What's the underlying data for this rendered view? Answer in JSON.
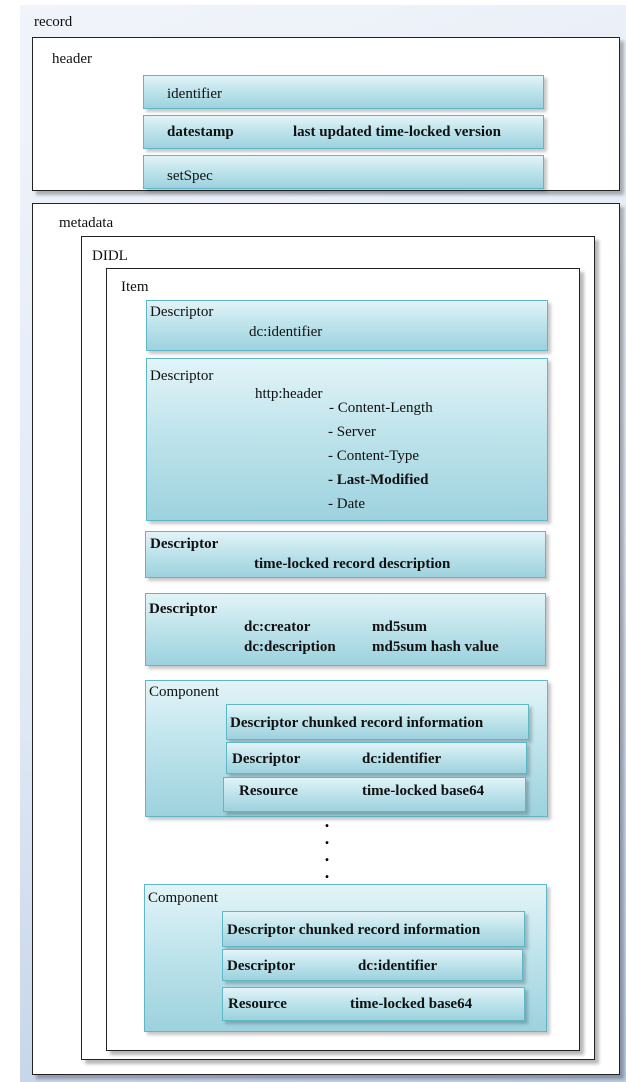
{
  "record": {
    "label": "record"
  },
  "header": {
    "label": "header",
    "identifier": "identifier",
    "datestamp": "datestamp",
    "datestamp_value": "last updated time-locked version",
    "setspec": "setSpec"
  },
  "metadata": {
    "label": "metadata"
  },
  "didl": {
    "label": "DIDL"
  },
  "item": {
    "label": "Item"
  },
  "descriptor1": {
    "label": "Descriptor",
    "value": "dc:identifier"
  },
  "descriptor2": {
    "label": "Descriptor",
    "key": "http:header",
    "fields": [
      "- Content-Length",
      "- Server",
      "- Content-Type",
      "- Last-Modified",
      "- Date"
    ]
  },
  "descriptor3": {
    "label": "Descriptor",
    "value": "time-locked record description"
  },
  "descriptor4": {
    "label": "Descriptor",
    "creator": "dc:creator",
    "creator_value": "md5sum",
    "description": "dc:description",
    "description_value": "md5sum hash value"
  },
  "component1": {
    "label": "Component",
    "descriptor_info": "Descriptor chunked record information",
    "descriptor": "Descriptor",
    "descriptor_value": "dc:identifier",
    "resource": "Resource",
    "resource_value": "time-locked base64"
  },
  "ellipsis": [
    ".",
    ".",
    ".",
    "."
  ],
  "component2": {
    "label": "Component",
    "descriptor_info": "Descriptor chunked record information",
    "descriptor": "Descriptor",
    "descriptor_value": "dc:identifier",
    "resource": "Resource",
    "resource_value": "time-locked base64"
  }
}
